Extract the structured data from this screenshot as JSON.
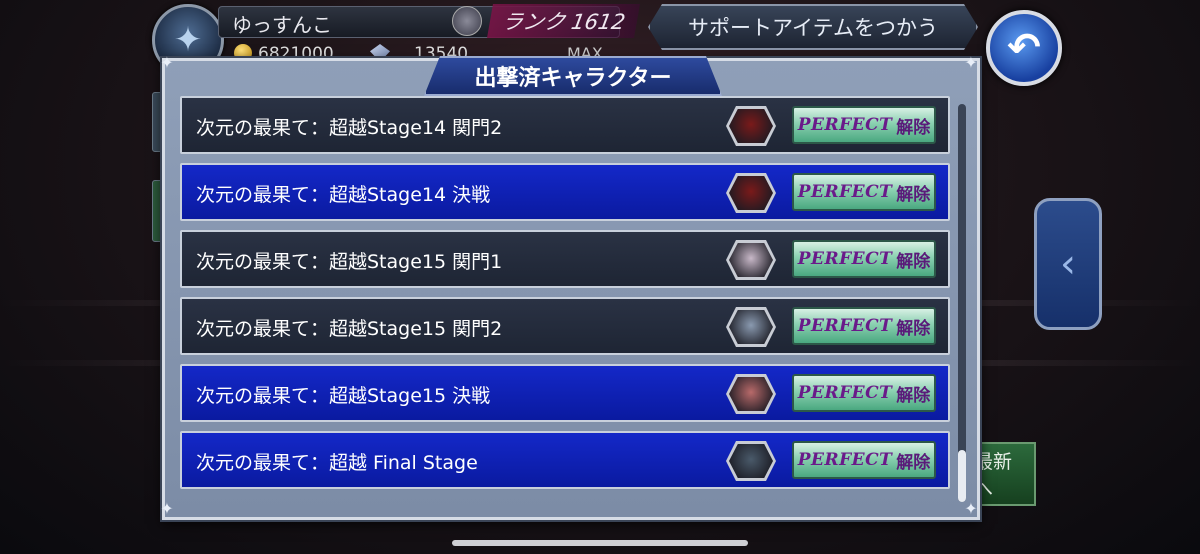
{
  "player": {
    "name": "ゆっすんこ",
    "rank": "ランク 1612",
    "gil": "6821000",
    "gems": "13540",
    "max_label": "MAX"
  },
  "buttons": {
    "support_items": "サポートアイテムをつかう",
    "back": "↶",
    "latest": "最新へ",
    "side_arrow": "‹"
  },
  "dialog": {
    "title": "出撃済キャラクター",
    "perfect_label": "PERFECT",
    "release_label": "解除",
    "rows": [
      {
        "label": "次元の最果て：超越Stage14 関門2",
        "style": "dark",
        "portrait_color": "#7a1a1a"
      },
      {
        "label": "次元の最果て：超越Stage14 決戦",
        "style": "blue",
        "portrait_color": "#7a1a1a"
      },
      {
        "label": "次元の最果て：超越Stage15 関門1",
        "style": "dark",
        "portrait_color": "#c8b8c8"
      },
      {
        "label": "次元の最果て：超越Stage15 関門2",
        "style": "dark",
        "portrait_color": "#8a9ab0"
      },
      {
        "label": "次元の最果て：超越Stage15 決戦",
        "style": "blue",
        "portrait_color": "#b86a6a"
      },
      {
        "label": "次元の最果て：超越 Final Stage",
        "style": "blue",
        "portrait_color": "#4a5a6a"
      }
    ]
  }
}
